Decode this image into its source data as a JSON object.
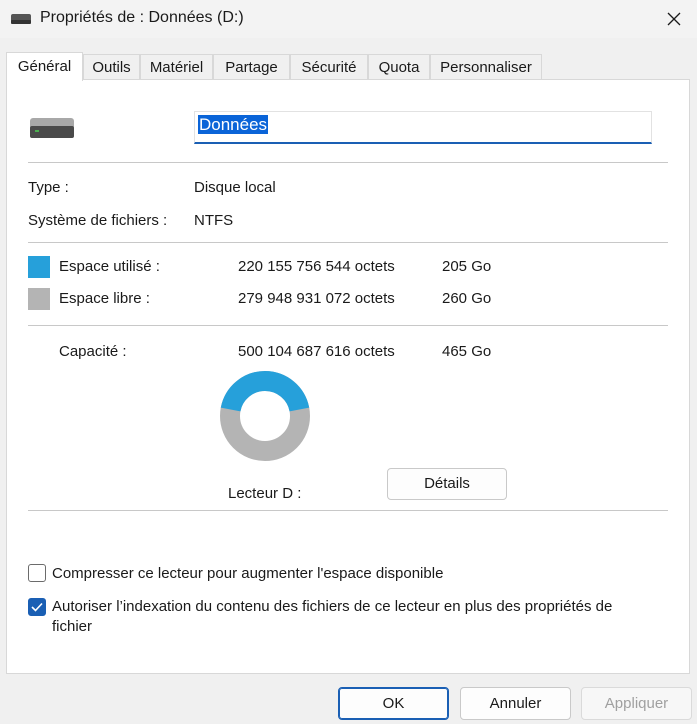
{
  "window": {
    "title": "Propriétés de : Données (D:)",
    "close_icon": "close-icon",
    "title_icon": "drive-icon"
  },
  "tabs": [
    {
      "label": "Général",
      "active": true
    },
    {
      "label": "Outils"
    },
    {
      "label": "Matériel"
    },
    {
      "label": "Partage"
    },
    {
      "label": "Sécurité"
    },
    {
      "label": "Quota"
    },
    {
      "label": "Personnaliser"
    }
  ],
  "general": {
    "drive_name": "Données",
    "type_label": "Type :",
    "type_value": "Disque local",
    "fs_label": "Système de fichiers :",
    "fs_value": "NTFS",
    "used": {
      "label": "Espace utilisé :",
      "bytes": "220 155 756 544 octets",
      "size": "205 Go",
      "color": "#26a0da"
    },
    "free": {
      "label": "Espace libre :",
      "bytes": "279 948 931 072 octets",
      "size": "260 Go",
      "color": "#b4b4b4"
    },
    "capacity": {
      "label": "Capacité :",
      "bytes": "500 104 687 616 octets",
      "size": "465 Go"
    },
    "used_fraction": 0.44,
    "drive_caption": "Lecteur D :",
    "details_button": "Détails",
    "compress": {
      "label": "Compresser ce lecteur pour augmenter l'espace disponible",
      "checked": false
    },
    "indexing": {
      "label_line1": "Autoriser l’indexation du contenu des fichiers de ce lecteur en plus des propriétés de",
      "label_line2": "fichier",
      "checked": true
    }
  },
  "buttons": {
    "ok": "OK",
    "cancel": "Annuler",
    "apply": "Appliquer"
  }
}
